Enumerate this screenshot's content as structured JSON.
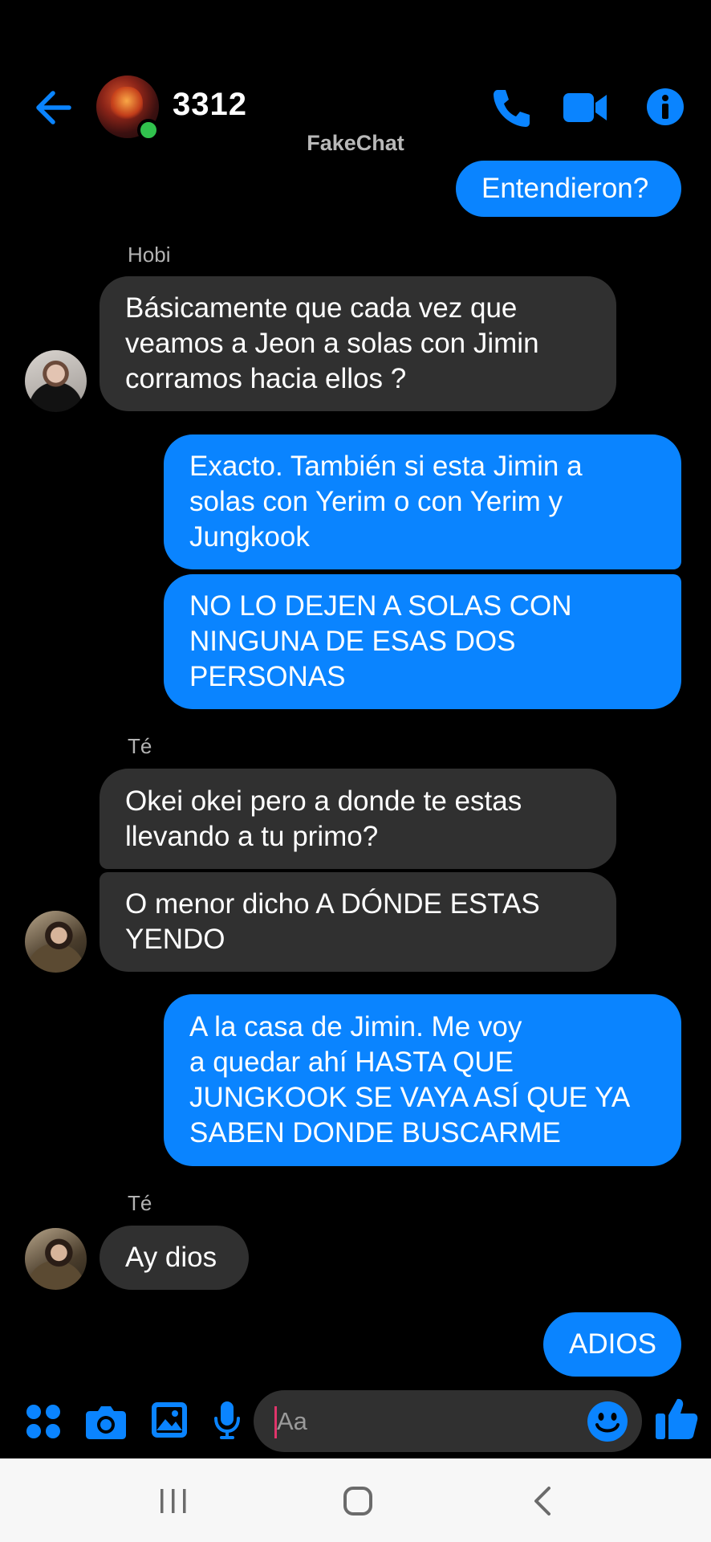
{
  "header": {
    "contact_name": "3312",
    "watermark": "FakeChat",
    "icons": [
      "back-arrow-icon",
      "phone-icon",
      "video-camera-icon",
      "info-icon"
    ],
    "accent_color": "#0a84ff",
    "online_color": "#31c24d"
  },
  "messages": [
    {
      "side": "sent",
      "text": "Entendieron?"
    },
    {
      "side": "label",
      "text": "Hobi"
    },
    {
      "side": "received",
      "sender": "Hobi",
      "lines": [
        "Básicamente que cada vez que",
        "veamos a Jeon a solas con Jimin",
        "corramos hacia ellos ?"
      ]
    },
    {
      "side": "sent",
      "lines": [
        "Exacto. También si esta Jimin a",
        "solas con Yerim o con Yerim y",
        "Jungkook"
      ]
    },
    {
      "side": "sent",
      "lines": [
        "NO LO DEJEN A SOLAS CON",
        "NINGUNA DE ESAS DOS",
        "PERSONAS"
      ]
    },
    {
      "side": "label",
      "text": "Té"
    },
    {
      "side": "received",
      "sender": "Té",
      "lines": [
        "Okei okei pero a donde te estas",
        "llevando a tu primo?"
      ]
    },
    {
      "side": "received",
      "sender": "Té",
      "lines": [
        "O menor dicho A DÓNDE ESTAS",
        "YENDO"
      ]
    },
    {
      "side": "sent",
      "lines": [
        "A la casa de Jimin. Me voy",
        "a quedar ahí HASTA QUE",
        "JUNGKOOK SE VAYA ASÍ QUE YA",
        "SABEN DONDE BUSCARME"
      ]
    },
    {
      "side": "label",
      "text": "Té"
    },
    {
      "side": "received",
      "sender": "Té",
      "text": "Ay dios"
    },
    {
      "side": "sent",
      "text": "ADIOS"
    }
  ],
  "composer": {
    "placeholder": "Aa",
    "icons": [
      "apps-grid-icon",
      "camera-icon",
      "gallery-icon",
      "microphone-icon",
      "emoji-icon",
      "thumbs-up-icon"
    ]
  },
  "navbar": {
    "icons": [
      "recent-apps-icon",
      "home-icon",
      "back-icon"
    ]
  }
}
